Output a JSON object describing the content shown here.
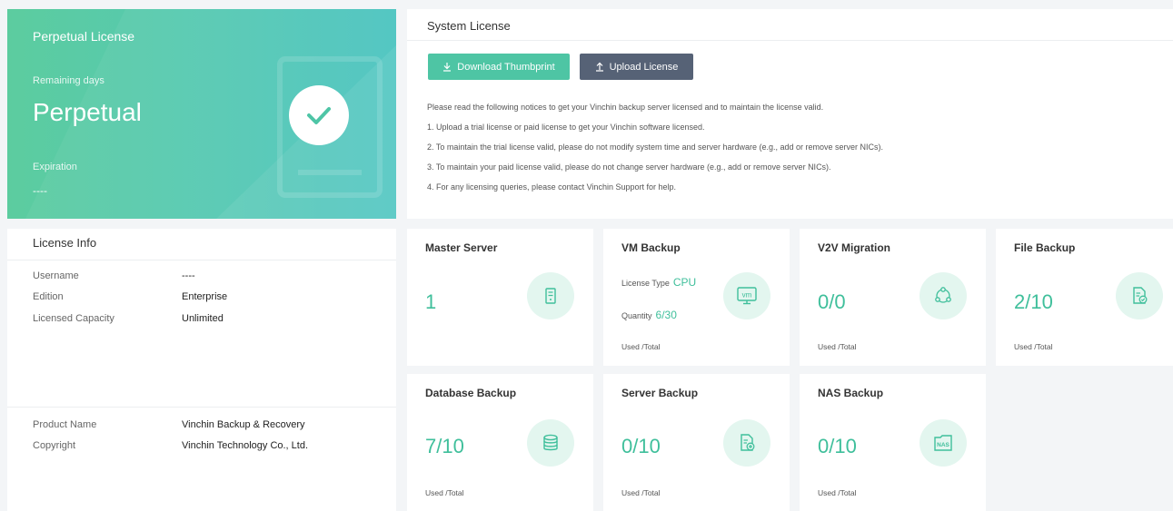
{
  "license_card": {
    "title": "Perpetual License",
    "remaining_label": "Remaining days",
    "remaining_value": "Perpetual",
    "expiration_label": "Expiration",
    "expiration_value": "----"
  },
  "license_info": {
    "title": "License Info",
    "username_label": "Username",
    "username_value": "----",
    "edition_label": "Edition",
    "edition_value": "Enterprise",
    "capacity_label": "Licensed Capacity",
    "capacity_value": "Unlimited",
    "product_label": "Product Name",
    "product_value": "Vinchin Backup & Recovery",
    "copyright_label": "Copyright",
    "copyright_value": "Vinchin Technology Co., Ltd."
  },
  "system_license": {
    "title": "System License",
    "download_button": "Download Thumbprint",
    "upload_button": "Upload License",
    "notices": [
      "Please read the following notices to get your Vinchin backup server licensed and to maintain the license valid.",
      "1. Upload a trial license or paid license to get your Vinchin software licensed.",
      "2. To maintain the trial license valid, please do not modify system time and server hardware (e.g., add or remove server NICs).",
      "3. To maintain your paid license valid, please do not change server hardware (e.g., add or remove server NICs).",
      "4. For any licensing queries, please contact Vinchin Support for help."
    ]
  },
  "cards": {
    "master": {
      "title": "Master Server",
      "value": "1"
    },
    "vm": {
      "title": "VM Backup",
      "license_type_label": "License Type",
      "license_type_value": "CPU",
      "quantity_label": "Quantity",
      "quantity_value": "6/30",
      "used": "Used /Total",
      "icon_text": "vm"
    },
    "v2v": {
      "title": "V2V Migration",
      "value": "0/0",
      "used": "Used /Total"
    },
    "file": {
      "title": "File Backup",
      "value": "2/10",
      "used": "Used /Total"
    },
    "database": {
      "title": "Database Backup",
      "value": "7/10",
      "used": "Used /Total"
    },
    "server": {
      "title": "Server Backup",
      "value": "0/10",
      "used": "Used /Total"
    },
    "nas": {
      "title": "NAS Backup",
      "value": "0/10",
      "used": "Used /Total",
      "icon_text": "NAS"
    }
  },
  "colors": {
    "accent": "#3fbf9b",
    "upload_button": "#566276",
    "hero_start": "#5ccc9f",
    "hero_end": "#4bc4c0"
  }
}
